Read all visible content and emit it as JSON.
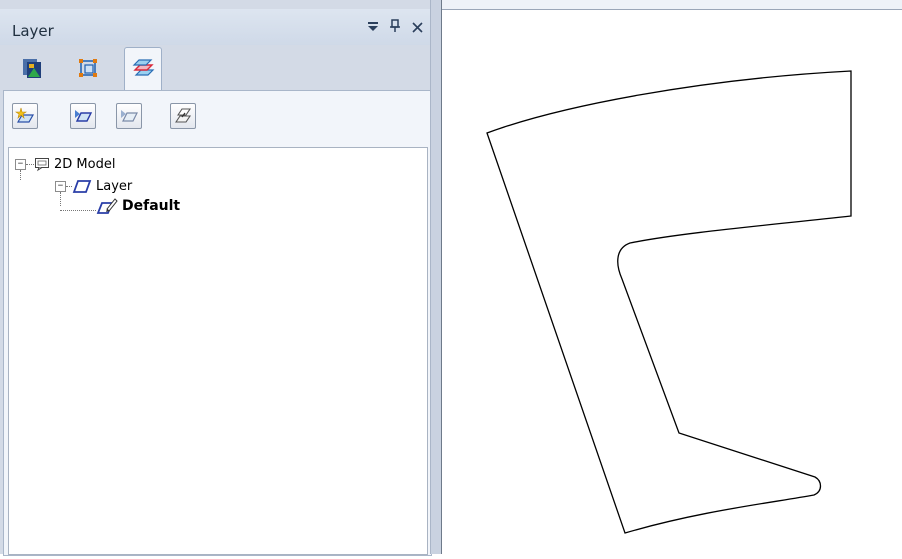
{
  "panel": {
    "title": "Layer",
    "header_buttons": [
      {
        "name": "dropdown-icon",
        "glyph": "▾"
      },
      {
        "name": "pin-icon",
        "glyph": "ꟷ"
      },
      {
        "name": "close-icon",
        "glyph": "✕"
      }
    ],
    "tabs": [
      {
        "name": "view-tab-icon",
        "active": false
      },
      {
        "name": "selection-tab-icon",
        "active": false
      },
      {
        "name": "layer-tab-icon",
        "active": true
      }
    ],
    "toolbar": [
      {
        "name": "new-layer-icon"
      },
      {
        "name": "activate-layer-icon"
      },
      {
        "name": "deactivate-layer-icon"
      },
      {
        "name": "layer-properties-icon"
      }
    ]
  },
  "tree": {
    "root": {
      "label": "2D Model",
      "expanded": true,
      "toggle": "−",
      "icon": "model-icon"
    },
    "group": {
      "label": "Layer",
      "expanded": true,
      "toggle": "−",
      "icon": "layer-icon"
    },
    "item": {
      "label": "Default",
      "icon": "active-layer-pencil-icon"
    }
  },
  "colors": {
    "panel_bg": "#d3dae6",
    "layer_icon": "#2a3ea8",
    "accent_red": "#d9283a"
  }
}
